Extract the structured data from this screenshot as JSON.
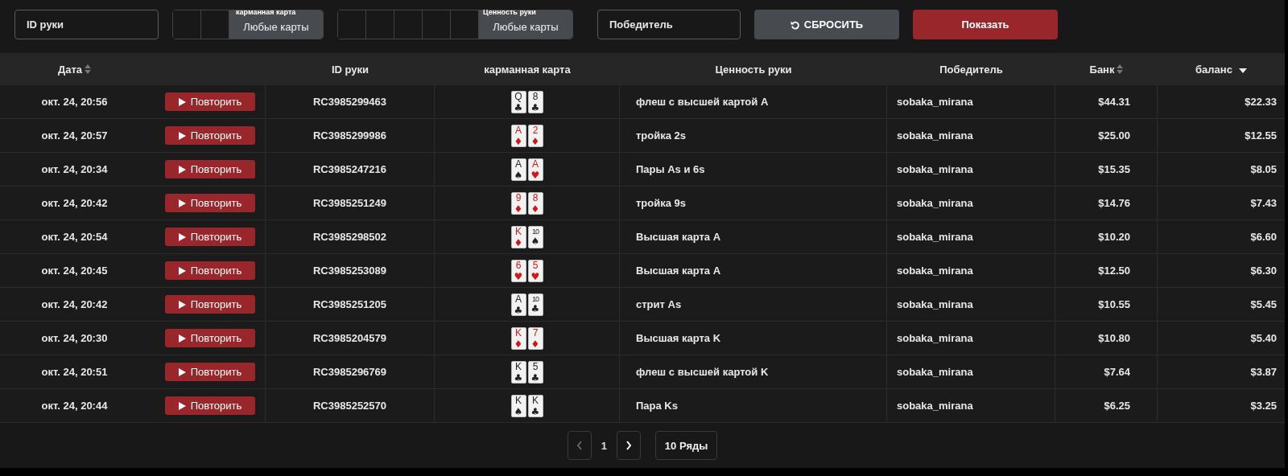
{
  "filters": {
    "hand_id": {
      "placeholder": "ID руки"
    },
    "hole_cards": {
      "kind": "hole",
      "label": "карманная карта",
      "button": "Любые карты"
    },
    "hand_value": {
      "kind": "board",
      "label": "Ценность руки",
      "button": "Любые карты"
    },
    "winner": {
      "placeholder": "Победитель"
    },
    "reset_button": "СБРОСИТЬ",
    "show_button": "Показать"
  },
  "table": {
    "columns": [
      {
        "label": "Дата",
        "sortable": true,
        "sorted": false
      },
      {
        "sortable": false,
        "sorted": false
      },
      {
        "label": "ID руки",
        "sortable": false,
        "sorted": false
      },
      {
        "label": "карманная карта",
        "sortable": false,
        "sorted": false
      },
      {
        "label": "Ценность руки",
        "sortable": false,
        "sorted": false
      },
      {
        "label": "Победитель",
        "sortable": false,
        "sorted": false
      },
      {
        "label": "Банк",
        "sortable": true,
        "sorted": false
      },
      {
        "label": "баланс",
        "sortable": true,
        "sorted": true
      }
    ],
    "rows": [
      {
        "date": "окт. 24, 20:56",
        "replay": "Повторить",
        "id": "RC3985299463",
        "cards": [
          {
            "rank": "Q",
            "suit": "♣",
            "red": false
          },
          {
            "rank": "8",
            "suit": "♣",
            "red": false
          }
        ],
        "value": "флеш с высшей картой A",
        "winner": "sobaka_mirana",
        "bank": "$44.31",
        "balance": "$22.33"
      },
      {
        "date": "окт. 24, 20:57",
        "replay": "Повторить",
        "id": "RC3985299986",
        "cards": [
          {
            "rank": "A",
            "suit": "♦",
            "red": true
          },
          {
            "rank": "2",
            "suit": "♦",
            "red": true
          }
        ],
        "value": "тройка 2s",
        "winner": "sobaka_mirana",
        "bank": "$25.00",
        "balance": "$12.55"
      },
      {
        "date": "окт. 24, 20:34",
        "replay": "Повторить",
        "id": "RC3985247216",
        "cards": [
          {
            "rank": "A",
            "suit": "♠",
            "red": false
          },
          {
            "rank": "A",
            "suit": "♥",
            "red": true
          }
        ],
        "value": "Пары As и 6s",
        "winner": "sobaka_mirana",
        "bank": "$15.35",
        "balance": "$8.05"
      },
      {
        "date": "окт. 24, 20:42",
        "replay": "Повторить",
        "id": "RC3985251249",
        "cards": [
          {
            "rank": "9",
            "suit": "♦",
            "red": true
          },
          {
            "rank": "8",
            "suit": "♦",
            "red": true
          }
        ],
        "value": "тройка 9s",
        "winner": "sobaka_mirana",
        "bank": "$14.76",
        "balance": "$7.43"
      },
      {
        "date": "окт. 24, 20:54",
        "replay": "Повторить",
        "id": "RC3985298502",
        "cards": [
          {
            "rank": "K",
            "suit": "♦",
            "red": true
          },
          {
            "rank": "10",
            "suit": "♠",
            "red": false
          }
        ],
        "value": "Высшая карта A",
        "winner": "sobaka_mirana",
        "bank": "$10.20",
        "balance": "$6.60"
      },
      {
        "date": "окт. 24, 20:45",
        "replay": "Повторить",
        "id": "RC3985253089",
        "cards": [
          {
            "rank": "6",
            "suit": "♥",
            "red": true
          },
          {
            "rank": "5",
            "suit": "♥",
            "red": true
          }
        ],
        "value": "Высшая карта A",
        "winner": "sobaka_mirana",
        "bank": "$12.50",
        "balance": "$6.30"
      },
      {
        "date": "окт. 24, 20:42",
        "replay": "Повторить",
        "id": "RC3985251205",
        "cards": [
          {
            "rank": "A",
            "suit": "♣",
            "red": false
          },
          {
            "rank": "10",
            "suit": "♣",
            "red": false
          }
        ],
        "value": "стрит As",
        "winner": "sobaka_mirana",
        "bank": "$10.55",
        "balance": "$5.45"
      },
      {
        "date": "окт. 24, 20:30",
        "replay": "Повторить",
        "id": "RC3985204579",
        "cards": [
          {
            "rank": "K",
            "suit": "♦",
            "red": true
          },
          {
            "rank": "7",
            "suit": "♦",
            "red": true
          }
        ],
        "value": "Высшая карта K",
        "winner": "sobaka_mirana",
        "bank": "$10.80",
        "balance": "$5.40"
      },
      {
        "date": "окт. 24, 20:51",
        "replay": "Повторить",
        "id": "RC3985296769",
        "cards": [
          {
            "rank": "K",
            "suit": "♣",
            "red": false
          },
          {
            "rank": "5",
            "suit": "♣",
            "red": false
          }
        ],
        "value": "флеш с высшей картой K",
        "winner": "sobaka_mirana",
        "bank": "$7.64",
        "balance": "$3.87"
      },
      {
        "date": "окт. 24, 20:44",
        "replay": "Повторить",
        "id": "RC3985252570",
        "cards": [
          {
            "rank": "K",
            "suit": "♠",
            "red": false
          },
          {
            "rank": "K",
            "suit": "♣",
            "red": false
          }
        ],
        "value": "Пара Ks",
        "winner": "sobaka_mirana",
        "bank": "$6.25",
        "balance": "$3.25"
      }
    ]
  },
  "pagination": {
    "prev_disabled": true,
    "page": "1",
    "next_disabled": false,
    "rows_per_page": "10 Ряды"
  }
}
